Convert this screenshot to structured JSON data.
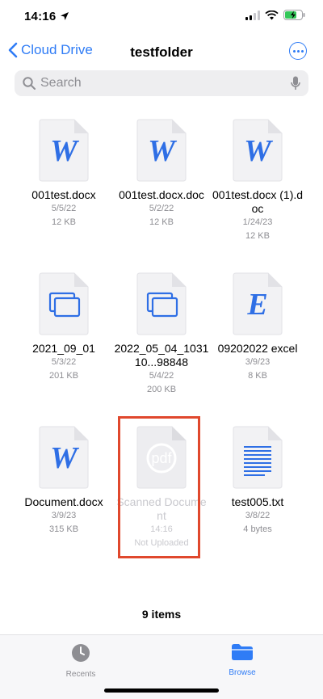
{
  "status_bar": {
    "time": "14:16",
    "icons": [
      "location-arrow-icon",
      "signal-icon",
      "wifi-icon",
      "battery-charging-icon"
    ]
  },
  "nav": {
    "back_label": "Cloud Drive",
    "title": "testfolder",
    "more_icon": "ellipsis-circle-icon"
  },
  "search": {
    "placeholder": "Search",
    "value": ""
  },
  "files": [
    {
      "name": "001test.docx",
      "date": "5/5/22",
      "size": "12 KB",
      "icon": "W"
    },
    {
      "name": "001test.docx.doc",
      "date": "5/2/22",
      "size": "12 KB",
      "icon": "W"
    },
    {
      "name": "001test.docx (1).doc",
      "date": "1/24/23",
      "size": "12 KB",
      "icon": "W"
    },
    {
      "name": "2021_09_01",
      "date": "5/3/22",
      "size": "201 KB",
      "icon": "windows"
    },
    {
      "name": "2022_05_04_103110...98848",
      "date": "5/4/22",
      "size": "200 KB",
      "icon": "windows"
    },
    {
      "name": "09202022 excel",
      "date": "3/9/23",
      "size": "8 KB",
      "icon": "E"
    },
    {
      "name": "Document.docx",
      "date": "3/9/23",
      "size": "315 KB",
      "icon": "W"
    },
    {
      "name": "Scanned Document",
      "date": "14:16",
      "size": "Not Uploaded",
      "icon": "pdf"
    },
    {
      "name": "test005.txt",
      "date": "3/8/22",
      "size": "4 bytes",
      "icon": "text"
    }
  ],
  "footer": {
    "item_count": "9 items"
  },
  "tabs": [
    {
      "label": "Recents",
      "icon": "clock-icon",
      "active": false
    },
    {
      "label": "Browse",
      "icon": "folder-icon",
      "active": true
    }
  ],
  "colors": {
    "accent": "#2f7cf6",
    "highlight": "#e0482d",
    "secondary_text": "#8e8e93"
  }
}
